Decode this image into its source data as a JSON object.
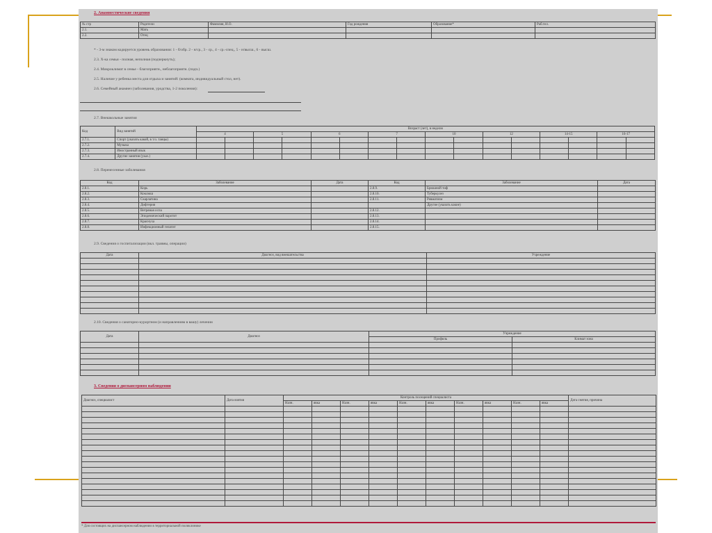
{
  "section2": {
    "title": "2. Анамнестические сведения",
    "parents_table": {
      "headers": [
        "№ стр",
        "Родители",
        "Фамилия, И.О.",
        "Год рождения",
        "Образование*",
        "Раб.тел."
      ],
      "rows": [
        [
          "2.1.",
          "Мать"
        ],
        [
          "2.2.",
          "Отец"
        ]
      ]
    },
    "notes": [
      "* - 3-м знаком кодируется уровень образования: 1 - б/обр. 2 - н/ср., 3 - ср., 4 - ср.-спец., 5 - н/высш., 6 - высш.",
      "2.3. Х-ка семьи - полная, неполная (подчеркнуть);",
      "2.4. Микроклимат в семье - благоприятн., неблагоприятн. (подч.)",
      "2.5. Наличие у ребенка места для отдыха и занятий: (комната, индивидуальный стол, нет).",
      "2.6. Семейный анамнез (заболевания, уродства, 1-2 поколения):"
    ]
  },
  "section27": {
    "title": "2.7. Внешкольные занятия",
    "headers": [
      "Код",
      "Вид занятий",
      "Возраст (лет), в неделю"
    ],
    "ages": [
      "4",
      "5",
      "6",
      "7",
      "10",
      "12",
      "14-15",
      "16-17"
    ],
    "rows": [
      [
        "2.7.1.",
        "Спорт (указать какой, в т.ч. танцы)"
      ],
      [
        "2.7.2.",
        "Музыка"
      ],
      [
        "2.7.3.",
        "Иностранный язык"
      ],
      [
        "2.7.4.",
        "Другие занятия (указ.)"
      ]
    ]
  },
  "section28": {
    "title": "2.8. Перенесенные заболевания",
    "headers": [
      "Код",
      "Заболевание",
      "Дата",
      "Код",
      "Заболевание",
      "Дата"
    ],
    "rows": [
      [
        "2.8.1.",
        "Корь",
        "2.8.9.",
        "Брюшной тиф"
      ],
      [
        "2.8.2.",
        "Коклюш",
        "2.8.10.",
        "Туберкулез"
      ],
      [
        "2.8.3.",
        "Скарлатина",
        "2.8.11.",
        "Ревматизм"
      ],
      [
        "2.8.4.",
        "Дифтерия",
        "",
        "Другие (указать какие)"
      ],
      [
        "2.8.5.",
        "Ветряная оспа",
        "2.8.12.",
        ""
      ],
      [
        "2.8.6.",
        "Эпидемический паротит",
        "2.8.13.",
        ""
      ],
      [
        "2.8.7.",
        "Краснуха",
        "2.8.14.",
        ""
      ],
      [
        "2.8.8.",
        "Инфекционный гепатит",
        "2.8.15.",
        ""
      ]
    ]
  },
  "section29": {
    "title": "2.9. Сведения о госпитализации (вкл. травмы, операции)",
    "headers": [
      "Дата",
      "Диагноз, вид вмешательства",
      "Учреждение"
    ]
  },
  "section210": {
    "title": "2.10. Сведения о санаторно-курортном (и направлениям в вашу) лечении",
    "headers": [
      "Дата",
      "Диагноз",
      "Учреждение"
    ],
    "subheaders": [
      "Профиль",
      "Климат зона"
    ]
  },
  "section3": {
    "title": "3. Сведения о диспансерном наблюдении",
    "headers": [
      "Диагноз, специалист",
      "Дата взятия",
      "Контроль посещений специалиста",
      "Дата снятия, причина"
    ],
    "visit_cols": [
      "Назн.",
      "явка",
      "Назн.",
      "явка",
      "Назн.",
      "явка",
      "Назн.",
      "явка",
      "Назн.",
      "явка"
    ]
  },
  "footnote": "* Для состоящих на диспансерном наблюдении в территориальной поликлинике",
  "colors": {
    "gold": "#d9a21a",
    "scan": "#cfcfcf",
    "accent": "#b0183a"
  }
}
